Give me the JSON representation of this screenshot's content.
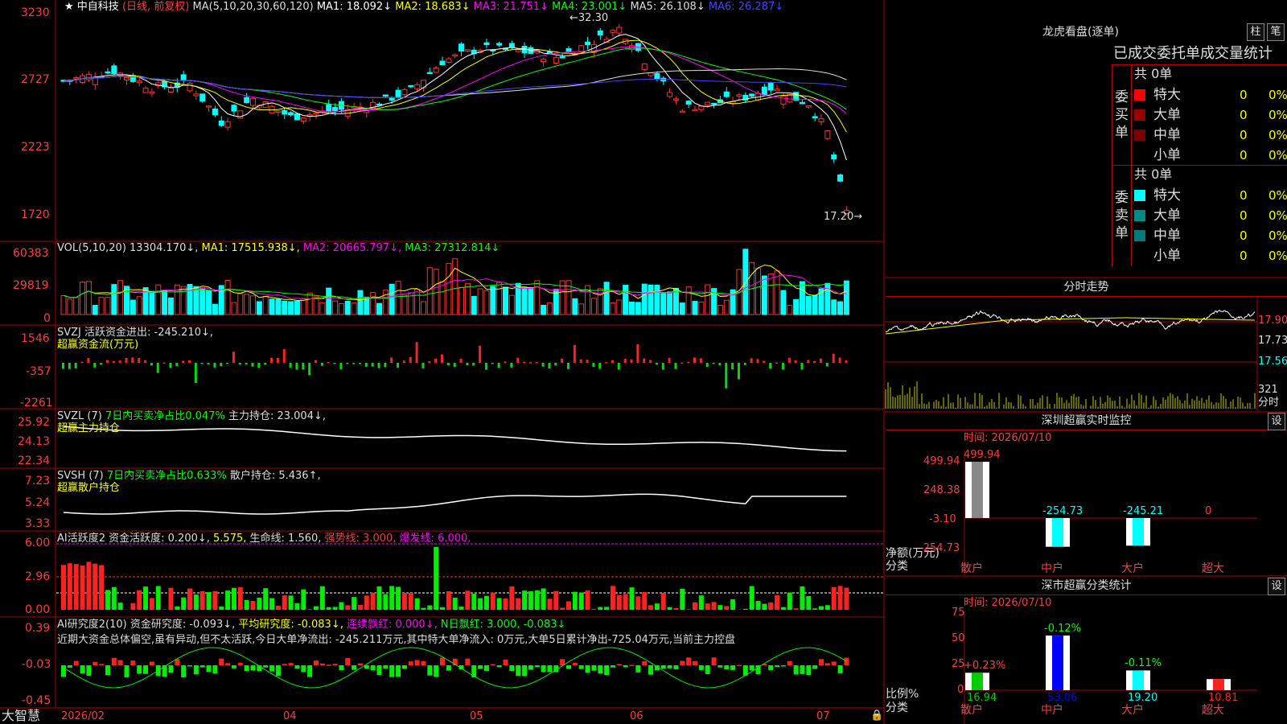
{
  "header": {
    "stock_name": "★ 中自科技",
    "period": "(日线, 前复权)",
    "ma_params": "MA(5,10,20,30,60,120)",
    "ma_values": [
      {
        "label": "MA1:",
        "value": "18.092↓",
        "color": "#ffffff"
      },
      {
        "label": "MA2:",
        "value": "18.683↓",
        "color": "#ffff00"
      },
      {
        "label": "MA3:",
        "value": "21.751↓",
        "color": "#ff00ff"
      },
      {
        "label": "MA4:",
        "value": "23.001↓",
        "color": "#00ff00"
      },
      {
        "label": "MA5:",
        "value": "26.108↓",
        "color": "#dddddd"
      },
      {
        "label": "MA6:",
        "value": "26.287↓",
        "color": "#4444ff"
      }
    ],
    "high_label": "32.30",
    "low_label": "17.20"
  },
  "price_axis": [
    "3230",
    "2727",
    "2223",
    "1720"
  ],
  "vol_panel": {
    "title": "VOL(5,10,20) 13304.170↓,",
    "ma1": "MA1: 17515.938↓,",
    "ma2": "MA2: 20665.797↓,",
    "ma3": "MA3: 27312.814↓",
    "axis": [
      "60383",
      "29819",
      "0"
    ]
  },
  "svzj_panel": {
    "title": "SVZJ  活跃资金进出: -245.210↓,",
    "subtitle": "超赢资金流(万元)",
    "axis": [
      "1546",
      "-357",
      "-2261"
    ]
  },
  "svzl_panel": {
    "title": "SVZL (7) ",
    "ratio": "7日内买卖净占比0.047%",
    "hold": " 主力持仓: 23.004↓,",
    "subtitle": "超赢主力持仓",
    "axis": [
      "25.92",
      "24.13",
      "22.34"
    ]
  },
  "svsh_panel": {
    "title": "SVSH (7) ",
    "ratio": "7日内买卖净占比0.633%",
    "hold": " 散户持仓: 5.436↑,",
    "subtitle": "超赢散户持仓",
    "axis": [
      "7.23",
      "5.24",
      "3.33"
    ]
  },
  "ai_active_panel": {
    "title": "AI活跃度2 资金活跃度: 0.200↓,",
    "v2": "5.575,",
    "life": " 生命线: 1.560,",
    "strong": " 强势线: 3.000,",
    "burst": " 爆发线: 6.000,",
    "axis": [
      "6.00",
      "2.96",
      "0.00"
    ]
  },
  "ai_research_panel": {
    "title": "AI研究度2(10) 资金研究度: -0.093↓,",
    "avg": " 平均研究度: -0.083↓,",
    "red": " 连续飘红: 0.000↓,",
    "nday": " N日飘红: 3.000, -0.083↓",
    "commentary": "近期大资金总体偏空,虽有异动,但不太活跃,今日大单净流出: -245.211万元,其中特大单净流入: 0万元,大单5日累计净出-725.04万元,当前主力控盘",
    "axis": [
      "0.39",
      "-0.03",
      "-0.45"
    ]
  },
  "bottom_bar": {
    "brand": "大智慧",
    "dates": [
      "2026/02",
      "04",
      "05",
      "06",
      "07"
    ]
  },
  "dragon_panel": {
    "title": "龙虎看盘(逐单)",
    "btn_bar": "柱",
    "btn_pen": "笔",
    "tabs": "已成交委托单成交量统计",
    "buy_label": "委买单",
    "sell_label": "委卖单",
    "buy_total": "共 0单",
    "sell_total": "共 0单",
    "rows": [
      {
        "name": "特大",
        "val": "0",
        "pct": "0%"
      },
      {
        "name": "大单",
        "val": "0",
        "pct": "0%"
      },
      {
        "name": "中单",
        "val": "0",
        "pct": "0%"
      },
      {
        "name": "小单",
        "val": "0",
        "pct": "0%"
      }
    ],
    "buy_colors": [
      "#ff0000",
      "#990000",
      "#770000",
      "#000000"
    ],
    "sell_colors": [
      "#00ffff",
      "#008b8b",
      "#007a7a",
      "#000000"
    ]
  },
  "intraday": {
    "title": "分时走势",
    "axis": [
      "17.90",
      "17.73",
      "17.56",
      "321",
      "分时"
    ]
  },
  "sz_monitor": {
    "title": "深圳超赢实时监控",
    "btn": "设",
    "time": "时间: 2026/07/10",
    "axis": [
      "499.94",
      "248.38",
      "-3.10",
      "-254.73"
    ],
    "ylabel1": "净额(万元)",
    "ylabel2": "分类",
    "bars": [
      {
        "cat": "散户",
        "label": "499.94",
        "value": 499.94
      },
      {
        "cat": "中户",
        "label": "-254.73",
        "value": -254.73
      },
      {
        "cat": "大户",
        "label": "-245.21",
        "value": -245.21
      },
      {
        "cat": "超大",
        "label": "0",
        "value": 0
      }
    ]
  },
  "sz_class": {
    "title": "深市超赢分类统计",
    "btn": "设",
    "time": "时间: 2026/07/10",
    "axis": [
      "75",
      "50",
      "25",
      "0"
    ],
    "ylabel1": "比例%",
    "ylabel2": "分类",
    "bars": [
      {
        "cat": "散户",
        "value": 16.94,
        "label": "16.94",
        "chg": "+0.23%"
      },
      {
        "cat": "中户",
        "value": 53.06,
        "label": "53.06",
        "chg": "-0.12%"
      },
      {
        "cat": "大户",
        "value": 19.2,
        "label": "19.20",
        "chg": "-0.11%"
      },
      {
        "cat": "超大",
        "value": 10.81,
        "label": "10.81",
        "chg": ""
      }
    ]
  }
}
